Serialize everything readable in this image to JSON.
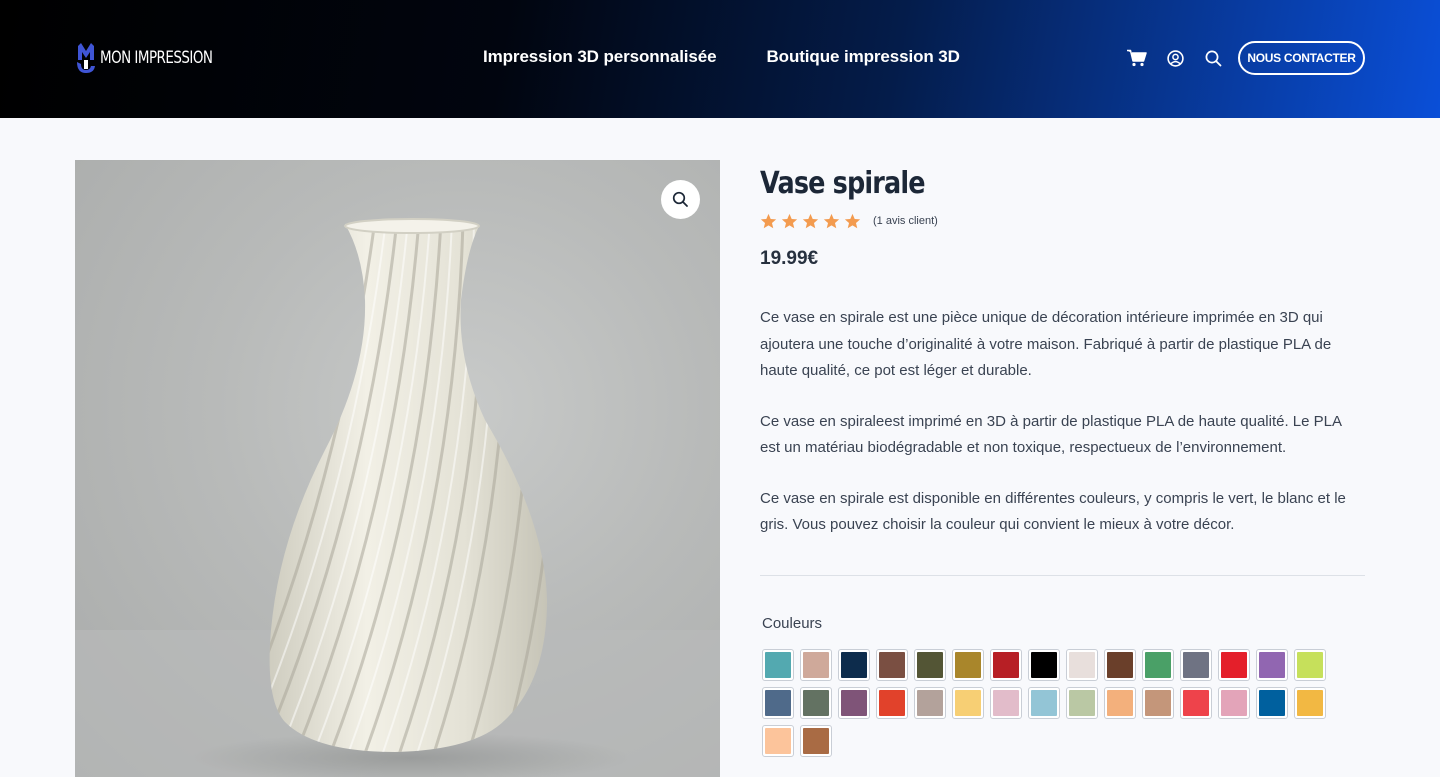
{
  "header": {
    "logo_text": "MON IMPRESSION",
    "nav": [
      {
        "label": "Impression 3D personnalisée"
      },
      {
        "label": "Boutique impression 3D"
      }
    ],
    "icons": [
      "cart-icon",
      "account-icon",
      "search-icon"
    ],
    "contact_label": "NOUS CONTACTER"
  },
  "product": {
    "title": "Vase spirale",
    "rating": 5,
    "rating_max": 5,
    "review_text": "(1 avis client)",
    "price": "19.99€",
    "description": [
      "Ce vase en spirale est une pièce unique de décoration intérieure imprimée en 3D qui ajoutera une touche d’originalité à votre maison. Fabriqué à partir de plastique PLA de haute qualité, ce pot est léger et durable.",
      "Ce vase en spiraleest imprimé en 3D à partir de plastique PLA de haute qualité. Le PLA est un matériau biodégradable et non toxique, respectueux de l’environnement.",
      "Ce vase en spirale est disponible en différentes couleurs, y compris le vert, le blanc et le gris. Vous pouvez choisir la couleur qui convient le mieux à votre décor."
    ],
    "colors_label": "Couleurs",
    "swatches": [
      "#53a9b0",
      "#cfa99a",
      "#0d2c4c",
      "#7a4f42",
      "#535535",
      "#a9862b",
      "#b71f25",
      "#000000",
      "#e8dfdc",
      "#6a3f2a",
      "#4aa067",
      "#6f7383",
      "#e41f2a",
      "#9166b1",
      "#c6e05b",
      "#4f6a8a",
      "#637262",
      "#7f5478",
      "#e1422b",
      "#b3a29b",
      "#f7cf74",
      "#e2bcca",
      "#93c5d6",
      "#bac8a4",
      "#f3b07c",
      "#c4967a",
      "#ee434b",
      "#e3a4b9",
      "#00609e",
      "#f2b843",
      "#fcc49b",
      "#a96b44"
    ]
  },
  "colors": {
    "accent_star": "#f39b4f",
    "button_border": "#ffffff",
    "heading": "#1c2737"
  }
}
